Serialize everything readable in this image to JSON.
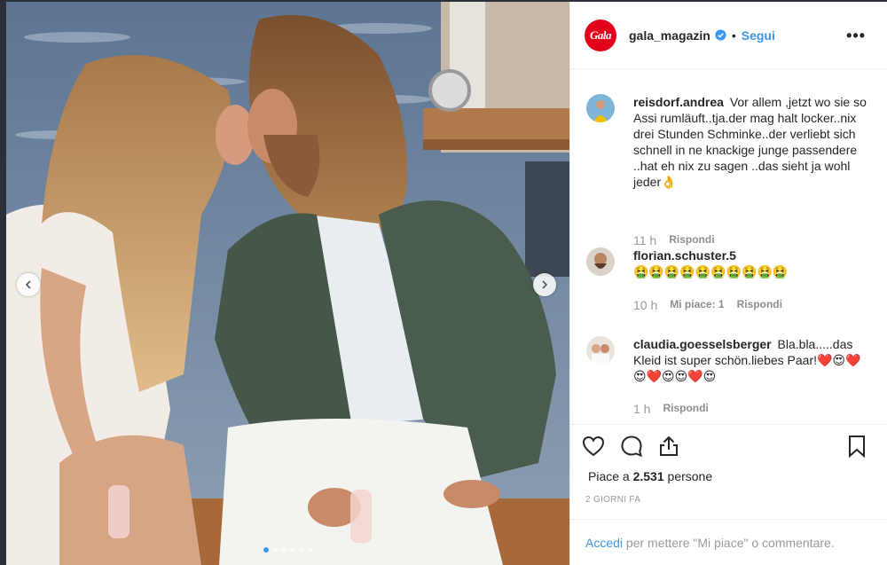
{
  "header": {
    "logo_text": "Gala",
    "username": "gala_magazin",
    "separator": "•",
    "follow_label": "Segui",
    "more_label": "•••"
  },
  "carousel": {
    "slide_count": 6,
    "active_index": 0
  },
  "comments": [
    {
      "username": "reisdorf.andrea",
      "text": "Vor allem ,jetzt wo sie so Assi rumläuft..tja.der mag halt locker..nix drei Stunden Schminke..der verliebt sich schnell in ne knackige junge passendere ..hat eh nix zu sagen ..das sieht ja wohl jeder👌",
      "time": "11 h",
      "likes": "",
      "reply_label": "Rispondi"
    },
    {
      "username": "florian.schuster.5",
      "text": "🤮🤮🤮🤮🤮🤮🤮🤮🤮🤮",
      "time": "10 h",
      "likes": "Mi piace: 1",
      "reply_label": "Rispondi"
    },
    {
      "username": "claudia.goesselsberger",
      "text": "Bla.bla.....das Kleid ist super schön.liebes Paar!❤️😍❤️😍❤️😍😍❤️😍",
      "time": "1 h",
      "likes": "",
      "reply_label": "Rispondi"
    }
  ],
  "likes": {
    "prefix": "Piace a ",
    "count": "2.531",
    "suffix": " persone"
  },
  "time_ago": "2 GIORNI FA",
  "login": {
    "link_label": "Accedi",
    "rest": " per mettere \"Mi piace\" o commentare."
  },
  "colors": {
    "accent": "#3897f0",
    "brand": "#e2001a",
    "muted": "#8e8e8e"
  },
  "icons": [
    "chevron-left-icon",
    "chevron-right-icon",
    "verified-badge-icon",
    "heart-icon",
    "comment-icon",
    "share-icon",
    "bookmark-icon",
    "more-icon"
  ]
}
